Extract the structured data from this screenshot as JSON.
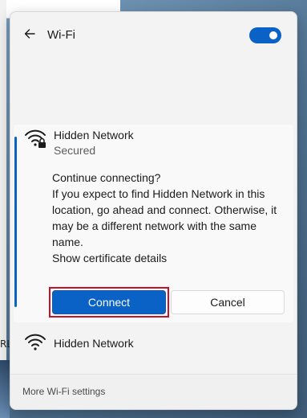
{
  "panel": {
    "title": "Wi-Fi",
    "wifi_toggle_on": true
  },
  "networks": [
    {
      "name": "Hidden Network",
      "status": "Secured",
      "expanded": true,
      "icon": "wifi-lock-icon",
      "prompt": {
        "heading": "Continue connecting?",
        "body": "If you expect to find Hidden Network in this location, go ahead and connect. Otherwise, it may be a different network with the same name.",
        "link": "Show certificate details"
      },
      "connect_label": "Connect",
      "cancel_label": "Cancel"
    },
    {
      "name": "Hidden Network",
      "icon": "wifi-icon"
    }
  ],
  "footer": {
    "settings_link": "More Wi-Fi settings"
  },
  "background": {
    "window_fragment_text": "RLF"
  },
  "colors": {
    "accent": "#0a62c6",
    "highlight_border": "#c8102e",
    "panel_bg": "#f3f3f3"
  }
}
